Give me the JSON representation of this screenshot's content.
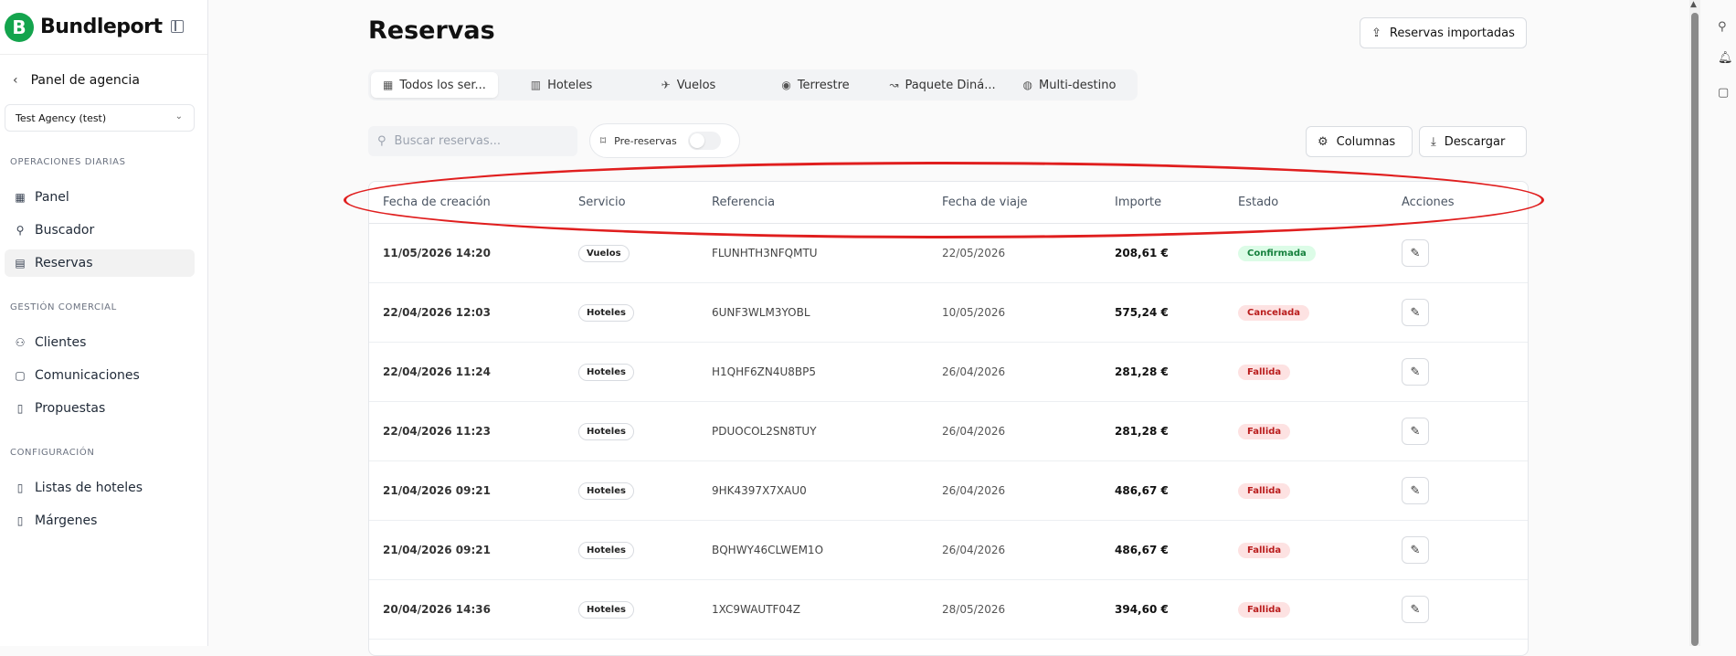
{
  "sidebar": {
    "logo_letter": "B",
    "logo_text": "Bundleport",
    "back_label": "Panel de agencia",
    "agency_value": "Test Agency (test)",
    "sections": {
      "daily": "OPERACIONES DIARIAS",
      "commercial": "GESTIÓN COMERCIAL",
      "config": "CONFIGURACIÓN"
    },
    "items": {
      "panel": "Panel",
      "buscador": "Buscador",
      "reservas": "Reservas",
      "clientes": "Clientes",
      "comunicaciones": "Comunicaciones",
      "propuestas": "Propuestas",
      "listas": "Listas de hoteles",
      "margenes": "Márgenes"
    }
  },
  "header": {
    "title": "Reservas",
    "imported_button": "Reservas importadas"
  },
  "tabs": [
    "Todos los ser...",
    "Hoteles",
    "Vuelos",
    "Terrestre",
    "Paquete Diná...",
    "Multi-destino"
  ],
  "toolbar": {
    "search_placeholder": "Buscar reservas...",
    "prebookings_label": "Pre-reservas",
    "prebookings_enabled": false,
    "columns_button": "Columnas",
    "download_button": "Descargar"
  },
  "table": {
    "columns": [
      "Fecha de creación",
      "Servicio",
      "Referencia",
      "Fecha de viaje",
      "Importe",
      "Estado",
      "Acciones"
    ],
    "rows": [
      {
        "created": "11/05/2026 14:20",
        "service": "Vuelos",
        "reference": "FLUNHTH3NFQMTU",
        "travel": "22/05/2026",
        "amount": "208,61 €",
        "status": "Confirmada"
      },
      {
        "created": "22/04/2026 12:03",
        "service": "Hoteles",
        "reference": "6UNF3WLM3YOBL",
        "travel": "10/05/2026",
        "amount": "575,24 €",
        "status": "Cancelada"
      },
      {
        "created": "22/04/2026 11:24",
        "service": "Hoteles",
        "reference": "H1QHF6ZN4U8BP5",
        "travel": "26/04/2026",
        "amount": "281,28 €",
        "status": "Fallida"
      },
      {
        "created": "22/04/2026 11:23",
        "service": "Hoteles",
        "reference": "PDUOCOL2SN8TUY",
        "travel": "26/04/2026",
        "amount": "281,28 €",
        "status": "Fallida"
      },
      {
        "created": "21/04/2026 09:21",
        "service": "Hoteles",
        "reference": "9HK4397X7XAU0",
        "travel": "26/04/2026",
        "amount": "486,67 €",
        "status": "Fallida"
      },
      {
        "created": "21/04/2026 09:21",
        "service": "Hoteles",
        "reference": "BQHWY46CLWEM1O",
        "travel": "26/04/2026",
        "amount": "486,67 €",
        "status": "Fallida"
      },
      {
        "created": "20/04/2026 14:36",
        "service": "Hoteles",
        "reference": "1XC9WAUTF04Z",
        "travel": "28/05/2026",
        "amount": "394,60 €",
        "status": "Fallida"
      }
    ]
  },
  "status_colors": {
    "Confirmada": {
      "bg": "#dcfce7",
      "fg": "#15803d"
    },
    "Cancelada": {
      "bg": "#fde2e2",
      "fg": "#b91c1c"
    },
    "Fallida": {
      "bg": "#fde2e2",
      "fg": "#b91c1c"
    }
  },
  "colors": {
    "brand": "#14a44d",
    "annotation": "#e01e1e"
  }
}
